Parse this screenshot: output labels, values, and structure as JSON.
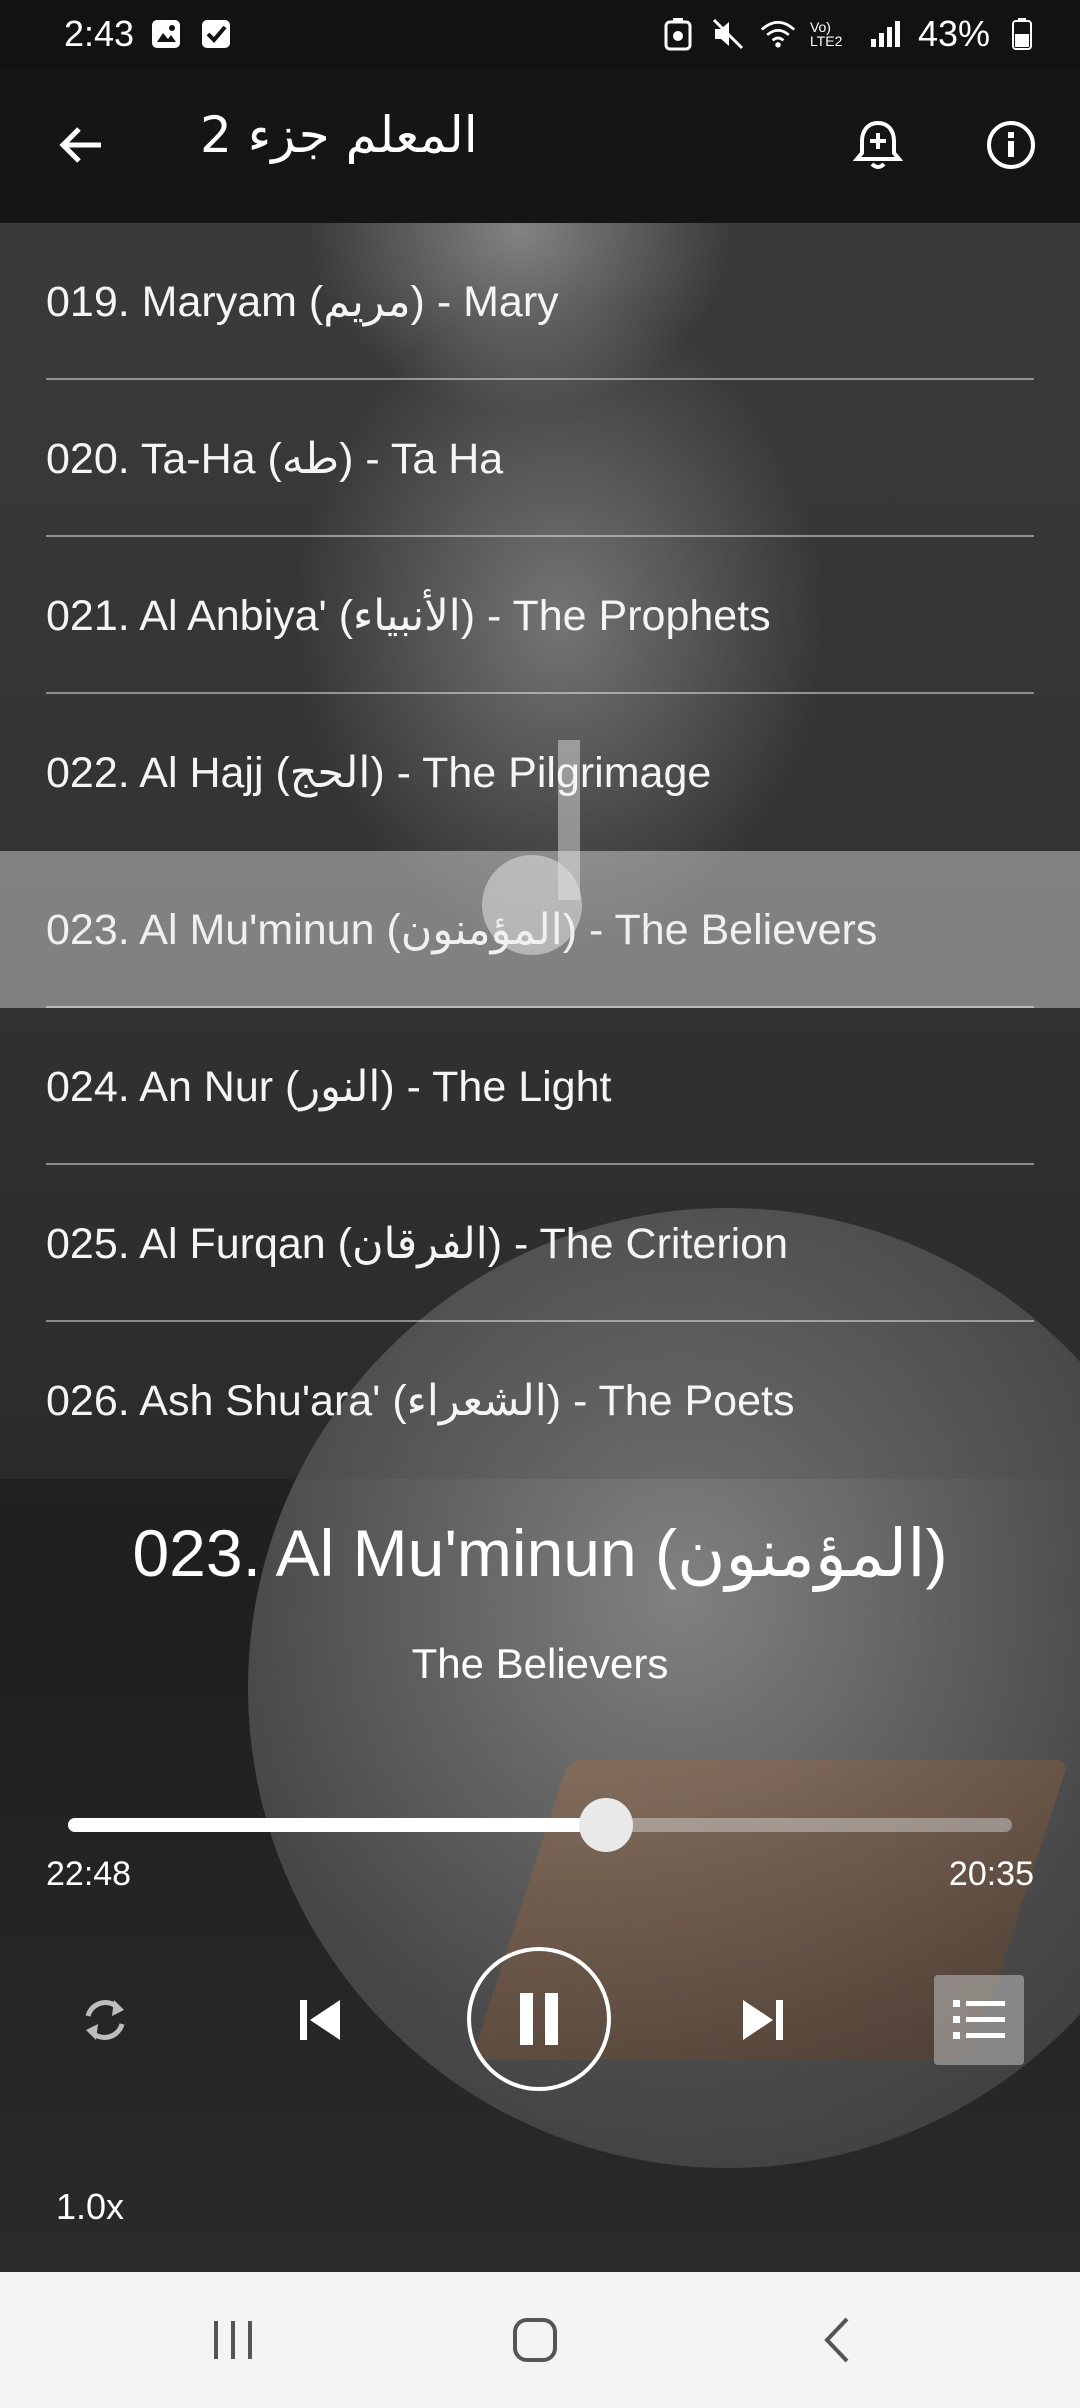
{
  "status_bar": {
    "time": "2:43",
    "battery": "43%",
    "network_label": "Vo) LTE2"
  },
  "app_bar": {
    "title": "المعلم جزء 2"
  },
  "surah_list": [
    {
      "label": "019. Maryam (مريم) - Mary",
      "active": false
    },
    {
      "label": "020. Ta-Ha (طه) - Ta Ha",
      "active": false
    },
    {
      "label": "021. Al Anbiya' (الأنبياء) - The Prophets",
      "active": false
    },
    {
      "label": "022. Al Hajj (الحج) - The Pilgrimage",
      "active": false
    },
    {
      "label": "023. Al Mu'minun (المؤمنون) - The Believers",
      "active": true
    },
    {
      "label": "024. An Nur (النور) - The Light",
      "active": false
    },
    {
      "label": "025. Al Furqan (الفرقان) - The Criterion",
      "active": false
    },
    {
      "label": "026. Ash Shu'ara' (الشعراء) - The Poets",
      "active": false
    }
  ],
  "player": {
    "title": "023. Al Mu'minun (المؤمنون)",
    "subtitle": "The Believers",
    "elapsed": "22:48",
    "remaining": "20:35",
    "progress": 0.57,
    "speed": "1.0x",
    "state": "playing"
  },
  "icons": {
    "back": "arrow-left-icon",
    "alarm": "alarm-add-icon",
    "info": "info-icon",
    "repeat": "repeat-icon",
    "prev": "skip-previous-icon",
    "pause": "pause-icon",
    "next": "skip-next-icon",
    "queue": "playlist-icon"
  },
  "colors": {
    "active_row": "#c8c8c8",
    "appbar": "#151515",
    "navbar": "#f4f4f4"
  }
}
